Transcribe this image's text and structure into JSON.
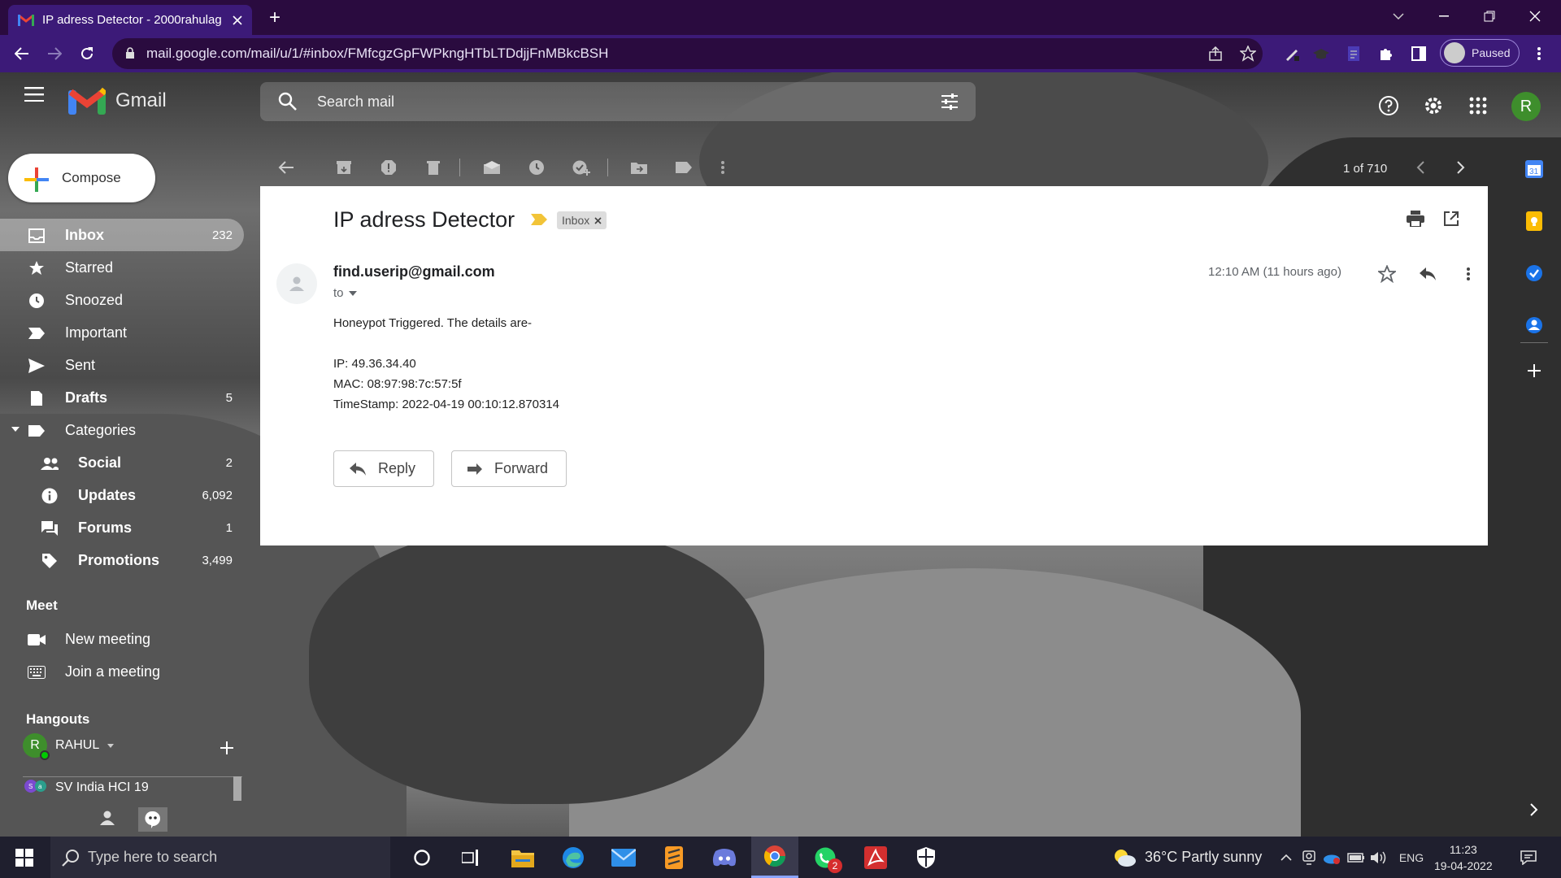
{
  "browser": {
    "tab_title": "IP adress Detector - 2000rahulag",
    "url": "mail.google.com/mail/u/1/#inbox/FMfcgzGpFWPkngHTbLTDdjjFnMBkcBSH",
    "profile_label": "Paused",
    "accent": "#3c1a78"
  },
  "gmail": {
    "app_name": "Gmail",
    "search_placeholder": "Search mail",
    "avatar_letter": "R",
    "compose_label": "Compose",
    "nav": [
      {
        "label": "Inbox",
        "count": "232",
        "icon": "inbox-icon"
      },
      {
        "label": "Starred",
        "count": "",
        "icon": "star-icon"
      },
      {
        "label": "Snoozed",
        "count": "",
        "icon": "clock-icon"
      },
      {
        "label": "Important",
        "count": "",
        "icon": "important-icon"
      },
      {
        "label": "Sent",
        "count": "",
        "icon": "send-icon"
      },
      {
        "label": "Drafts",
        "count": "5",
        "icon": "draft-icon"
      },
      {
        "label": "Categories",
        "count": "",
        "icon": "label-icon"
      }
    ],
    "categories": [
      {
        "label": "Social",
        "count": "2",
        "icon": "people-icon"
      },
      {
        "label": "Updates",
        "count": "6,092",
        "icon": "info-icon"
      },
      {
        "label": "Forums",
        "count": "1",
        "icon": "forum-icon"
      },
      {
        "label": "Promotions",
        "count": "3,499",
        "icon": "tag-icon"
      }
    ],
    "meet": {
      "heading": "Meet",
      "new_meeting": "New meeting",
      "join_meeting": "Join a meeting"
    },
    "hangouts": {
      "heading": "Hangouts",
      "user": "RAHUL",
      "user_initial": "R",
      "group": "SV India HCI 19"
    },
    "pager": "1 of 710",
    "message": {
      "subject": "IP adress Detector",
      "label": "Inbox",
      "sender": "find.userip@gmail.com",
      "to": "to",
      "time": "12:10 AM (11 hours ago)",
      "body": [
        "Honeypot Triggered. The details are-",
        "IP: 49.36.34.40",
        "MAC: 08:97:98:7c:57:5f",
        "TimeStamp: 2022-04-19 00:10:12.870314"
      ],
      "reply_label": "Reply",
      "forward_label": "Forward"
    }
  },
  "taskbar": {
    "search_placeholder": "Type here to search",
    "weather": "36°C  Partly sunny",
    "lang": "ENG",
    "time": "11:23",
    "date": "19-04-2022",
    "whatsapp_badge": "2"
  }
}
